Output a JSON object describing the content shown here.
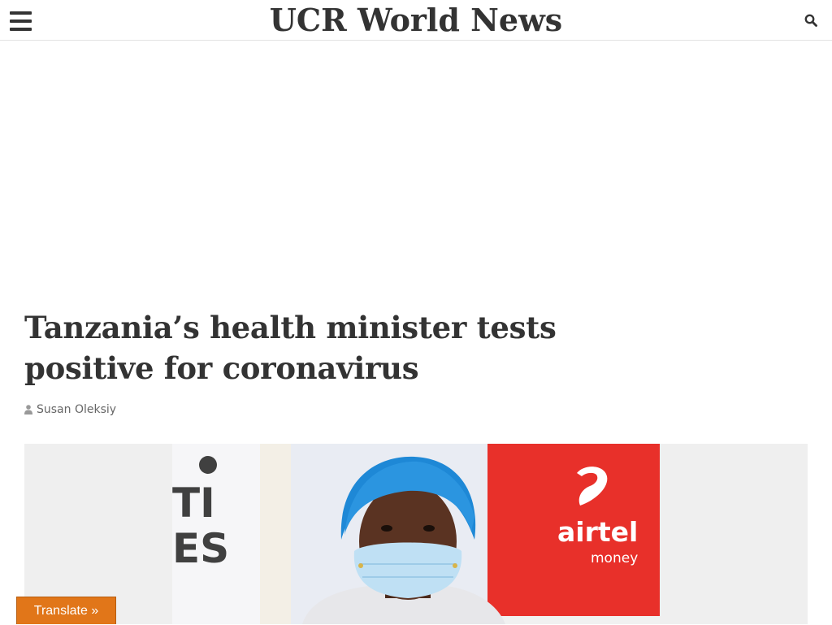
{
  "header": {
    "site_title": "UCR World News",
    "menu_icon": "hamburger-menu-icon",
    "search_icon": "search-icon"
  },
  "article": {
    "title": "Tanzania’s health minister tests positive for coronavirus",
    "author": "Susan Oleksiy",
    "author_icon": "user-icon",
    "featured_image": {
      "backdrop_text_left": "TI ES",
      "brand_logo_text": "airtel",
      "brand_logo_subtext": "money"
    }
  },
  "translate_widget": {
    "label": "Translate »"
  },
  "colors": {
    "text": "#333333",
    "byline": "#666666",
    "translate_bg": "#e17619",
    "airtel_red": "#e8302a"
  }
}
